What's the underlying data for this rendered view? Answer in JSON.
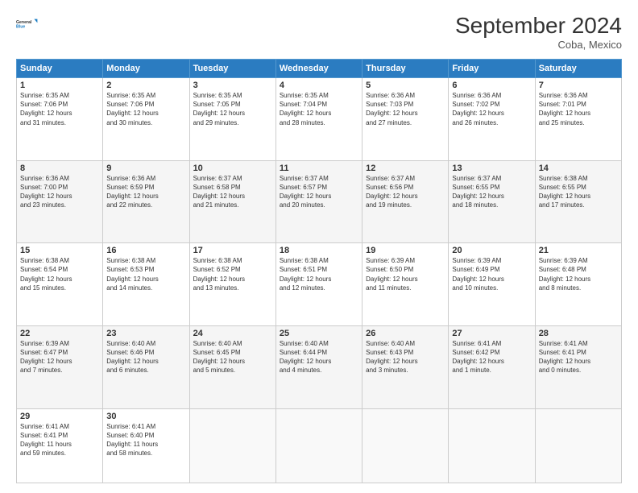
{
  "logo": {
    "line1": "General",
    "line2": "Blue"
  },
  "title": "September 2024",
  "location": "Coba, Mexico",
  "days_header": [
    "Sunday",
    "Monday",
    "Tuesday",
    "Wednesday",
    "Thursday",
    "Friday",
    "Saturday"
  ],
  "weeks": [
    [
      {
        "day": "1",
        "text": "Sunrise: 6:35 AM\nSunset: 7:06 PM\nDaylight: 12 hours\nand 31 minutes."
      },
      {
        "day": "2",
        "text": "Sunrise: 6:35 AM\nSunset: 7:06 PM\nDaylight: 12 hours\nand 30 minutes."
      },
      {
        "day": "3",
        "text": "Sunrise: 6:35 AM\nSunset: 7:05 PM\nDaylight: 12 hours\nand 29 minutes."
      },
      {
        "day": "4",
        "text": "Sunrise: 6:35 AM\nSunset: 7:04 PM\nDaylight: 12 hours\nand 28 minutes."
      },
      {
        "day": "5",
        "text": "Sunrise: 6:36 AM\nSunset: 7:03 PM\nDaylight: 12 hours\nand 27 minutes."
      },
      {
        "day": "6",
        "text": "Sunrise: 6:36 AM\nSunset: 7:02 PM\nDaylight: 12 hours\nand 26 minutes."
      },
      {
        "day": "7",
        "text": "Sunrise: 6:36 AM\nSunset: 7:01 PM\nDaylight: 12 hours\nand 25 minutes."
      }
    ],
    [
      {
        "day": "8",
        "text": "Sunrise: 6:36 AM\nSunset: 7:00 PM\nDaylight: 12 hours\nand 23 minutes."
      },
      {
        "day": "9",
        "text": "Sunrise: 6:36 AM\nSunset: 6:59 PM\nDaylight: 12 hours\nand 22 minutes."
      },
      {
        "day": "10",
        "text": "Sunrise: 6:37 AM\nSunset: 6:58 PM\nDaylight: 12 hours\nand 21 minutes."
      },
      {
        "day": "11",
        "text": "Sunrise: 6:37 AM\nSunset: 6:57 PM\nDaylight: 12 hours\nand 20 minutes."
      },
      {
        "day": "12",
        "text": "Sunrise: 6:37 AM\nSunset: 6:56 PM\nDaylight: 12 hours\nand 19 minutes."
      },
      {
        "day": "13",
        "text": "Sunrise: 6:37 AM\nSunset: 6:55 PM\nDaylight: 12 hours\nand 18 minutes."
      },
      {
        "day": "14",
        "text": "Sunrise: 6:38 AM\nSunset: 6:55 PM\nDaylight: 12 hours\nand 17 minutes."
      }
    ],
    [
      {
        "day": "15",
        "text": "Sunrise: 6:38 AM\nSunset: 6:54 PM\nDaylight: 12 hours\nand 15 minutes."
      },
      {
        "day": "16",
        "text": "Sunrise: 6:38 AM\nSunset: 6:53 PM\nDaylight: 12 hours\nand 14 minutes."
      },
      {
        "day": "17",
        "text": "Sunrise: 6:38 AM\nSunset: 6:52 PM\nDaylight: 12 hours\nand 13 minutes."
      },
      {
        "day": "18",
        "text": "Sunrise: 6:38 AM\nSunset: 6:51 PM\nDaylight: 12 hours\nand 12 minutes."
      },
      {
        "day": "19",
        "text": "Sunrise: 6:39 AM\nSunset: 6:50 PM\nDaylight: 12 hours\nand 11 minutes."
      },
      {
        "day": "20",
        "text": "Sunrise: 6:39 AM\nSunset: 6:49 PM\nDaylight: 12 hours\nand 10 minutes."
      },
      {
        "day": "21",
        "text": "Sunrise: 6:39 AM\nSunset: 6:48 PM\nDaylight: 12 hours\nand 8 minutes."
      }
    ],
    [
      {
        "day": "22",
        "text": "Sunrise: 6:39 AM\nSunset: 6:47 PM\nDaylight: 12 hours\nand 7 minutes."
      },
      {
        "day": "23",
        "text": "Sunrise: 6:40 AM\nSunset: 6:46 PM\nDaylight: 12 hours\nand 6 minutes."
      },
      {
        "day": "24",
        "text": "Sunrise: 6:40 AM\nSunset: 6:45 PM\nDaylight: 12 hours\nand 5 minutes."
      },
      {
        "day": "25",
        "text": "Sunrise: 6:40 AM\nSunset: 6:44 PM\nDaylight: 12 hours\nand 4 minutes."
      },
      {
        "day": "26",
        "text": "Sunrise: 6:40 AM\nSunset: 6:43 PM\nDaylight: 12 hours\nand 3 minutes."
      },
      {
        "day": "27",
        "text": "Sunrise: 6:41 AM\nSunset: 6:42 PM\nDaylight: 12 hours\nand 1 minute."
      },
      {
        "day": "28",
        "text": "Sunrise: 6:41 AM\nSunset: 6:41 PM\nDaylight: 12 hours\nand 0 minutes."
      }
    ],
    [
      {
        "day": "29",
        "text": "Sunrise: 6:41 AM\nSunset: 6:41 PM\nDaylight: 11 hours\nand 59 minutes."
      },
      {
        "day": "30",
        "text": "Sunrise: 6:41 AM\nSunset: 6:40 PM\nDaylight: 11 hours\nand 58 minutes."
      },
      {
        "day": "",
        "text": ""
      },
      {
        "day": "",
        "text": ""
      },
      {
        "day": "",
        "text": ""
      },
      {
        "day": "",
        "text": ""
      },
      {
        "day": "",
        "text": ""
      }
    ]
  ]
}
